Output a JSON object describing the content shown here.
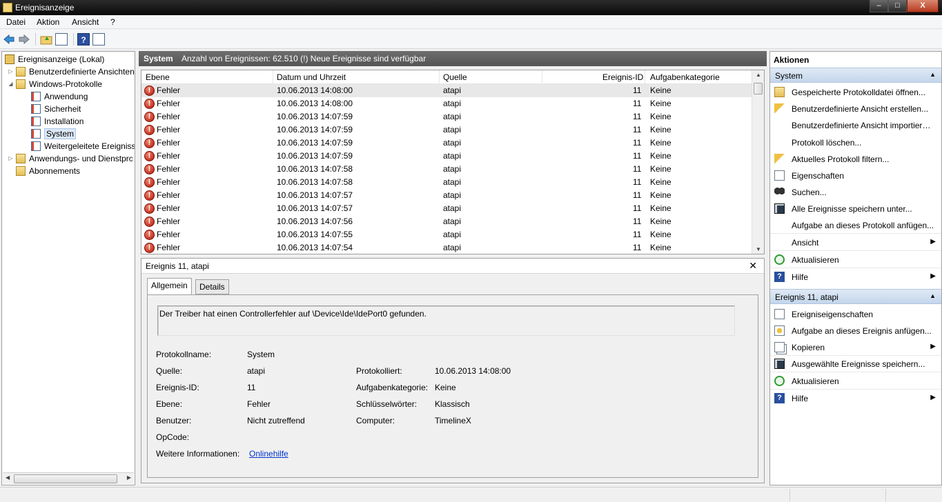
{
  "window": {
    "title": "Ereignisanzeige",
    "min": "–",
    "max": "□",
    "close": "X"
  },
  "menu": [
    "Datei",
    "Aktion",
    "Ansicht",
    "?"
  ],
  "toolbar": {
    "help_label": "?"
  },
  "tree": {
    "root": "Ereignisanzeige (Lokal)",
    "custom_views": "Benutzerdefinierte Ansichten",
    "windows_logs": "Windows-Protokolle",
    "application": "Anwendung",
    "security": "Sicherheit",
    "setup": "Installation",
    "system": "System",
    "forwarded": "Weitergeleitete Ereignisse",
    "app_services": "Anwendungs- und Dienstprotokolle",
    "subscriptions": "Abonnements"
  },
  "center": {
    "title": "System",
    "info": "Anzahl von Ereignissen: 62.510 (!) Neue Ereignisse sind verfügbar"
  },
  "table": {
    "columns": [
      "Ebene",
      "Datum und Uhrzeit",
      "Quelle",
      "Ereignis-ID",
      "Aufgabenkategorie"
    ],
    "rows": [
      {
        "level": "Fehler",
        "date": "10.06.2013 14:08:00",
        "source": "atapi",
        "id": "11",
        "category": "Keine"
      },
      {
        "level": "Fehler",
        "date": "10.06.2013 14:08:00",
        "source": "atapi",
        "id": "11",
        "category": "Keine"
      },
      {
        "level": "Fehler",
        "date": "10.06.2013 14:07:59",
        "source": "atapi",
        "id": "11",
        "category": "Keine"
      },
      {
        "level": "Fehler",
        "date": "10.06.2013 14:07:59",
        "source": "atapi",
        "id": "11",
        "category": "Keine"
      },
      {
        "level": "Fehler",
        "date": "10.06.2013 14:07:59",
        "source": "atapi",
        "id": "11",
        "category": "Keine"
      },
      {
        "level": "Fehler",
        "date": "10.06.2013 14:07:59",
        "source": "atapi",
        "id": "11",
        "category": "Keine"
      },
      {
        "level": "Fehler",
        "date": "10.06.2013 14:07:58",
        "source": "atapi",
        "id": "11",
        "category": "Keine"
      },
      {
        "level": "Fehler",
        "date": "10.06.2013 14:07:58",
        "source": "atapi",
        "id": "11",
        "category": "Keine"
      },
      {
        "level": "Fehler",
        "date": "10.06.2013 14:07:57",
        "source": "atapi",
        "id": "11",
        "category": "Keine"
      },
      {
        "level": "Fehler",
        "date": "10.06.2013 14:07:57",
        "source": "atapi",
        "id": "11",
        "category": "Keine"
      },
      {
        "level": "Fehler",
        "date": "10.06.2013 14:07:56",
        "source": "atapi",
        "id": "11",
        "category": "Keine"
      },
      {
        "level": "Fehler",
        "date": "10.06.2013 14:07:55",
        "source": "atapi",
        "id": "11",
        "category": "Keine"
      },
      {
        "level": "Fehler",
        "date": "10.06.2013 14:07:54",
        "source": "atapi",
        "id": "11",
        "category": "Keine"
      }
    ]
  },
  "details": {
    "title": "Ereignis 11, atapi",
    "tabs": [
      "Allgemein",
      "Details"
    ],
    "message": "Der Treiber hat einen Controllerfehler auf \\Device\\Ide\\IdePort0 gefunden.",
    "labels": {
      "log_name": "Protokollname:",
      "source": "Quelle:",
      "event_id": "Ereignis-ID:",
      "level": "Ebene:",
      "user": "Benutzer:",
      "opcode": "OpCode:",
      "more_info": "Weitere Informationen:",
      "logged": "Protokolliert:",
      "task_category": "Aufgabenkategorie:",
      "keywords": "Schlüsselwörter:",
      "computer": "Computer:"
    },
    "values": {
      "log_name": "System",
      "source": "atapi",
      "event_id": "11",
      "level": "Fehler",
      "user": "Nicht zutreffend",
      "opcode": "",
      "more_info_link": "Onlinehilfe",
      "logged": "10.06.2013 14:08:00",
      "task_category": "Keine",
      "keywords": "Klassisch",
      "computer": "TimelineX"
    }
  },
  "actions": {
    "title": "Aktionen",
    "section1": "System",
    "items1": [
      "Gespeicherte Protokolldatei öffnen...",
      "Benutzerdefinierte Ansicht erstellen...",
      "Benutzerdefinierte Ansicht importieren...",
      "Protokoll löschen...",
      "Aktuelles Protokoll filtern...",
      "Eigenschaften",
      "Suchen...",
      "Alle Ereignisse speichern unter...",
      "Aufgabe an dieses Protokoll anfügen...",
      "Ansicht",
      "Aktualisieren",
      "Hilfe"
    ],
    "section2": "Ereignis 11, atapi",
    "items2": [
      "Ereigniseigenschaften",
      "Aufgabe an dieses Ereignis anfügen...",
      "Kopieren",
      "Ausgewählte Ereignisse speichern...",
      "Aktualisieren",
      "Hilfe"
    ],
    "help_glyph": "?"
  },
  "colors": {
    "header_bg": "#5f5f5f",
    "section_bg": "#c9daee",
    "error_red": "#c8200e",
    "link": "#0033cc"
  }
}
